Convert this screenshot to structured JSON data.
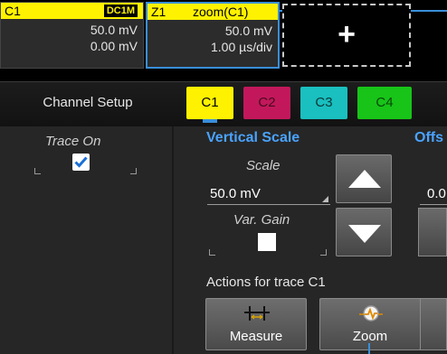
{
  "descriptors": {
    "c1": {
      "name": "C1",
      "tag": "DC1M",
      "scale": "50.0 mV",
      "offset": "0.00 mV"
    },
    "z1": {
      "name": "Z1",
      "source": "zoom(C1)",
      "scale": "50.0 mV",
      "timebase": "1.00 µs/div"
    },
    "add_trace_symbol": "+"
  },
  "tabs": {
    "setup_label": "Channel Setup",
    "items": [
      {
        "label": "C1",
        "color": "#fff200"
      },
      {
        "label": "C2",
        "color": "#c2185b"
      },
      {
        "label": "C3",
        "color": "#1abfbf"
      },
      {
        "label": "C4",
        "color": "#18c418"
      }
    ]
  },
  "panel": {
    "trace_on_label": "Trace On",
    "trace_on_checked": true,
    "vertical_scale_title": "Vertical Scale",
    "offset_title": "Offs",
    "scale_label": "Scale",
    "scale_value": "50.0 mV",
    "offset_value_partial": "0.0",
    "var_gain_label": "Var. Gain",
    "var_gain_checked": false,
    "actions_title": "Actions for trace C1",
    "measure_label": "Measure",
    "zoom_label": "Zoom"
  },
  "colors": {
    "accent": "#4aa3ff",
    "c1": "#fff200",
    "zoom_border": "#3a8fd8"
  },
  "icons": [
    "up-arrow-icon",
    "down-arrow-icon",
    "measure-icon",
    "zoom-icon",
    "checkmark-icon",
    "plus-icon"
  ]
}
